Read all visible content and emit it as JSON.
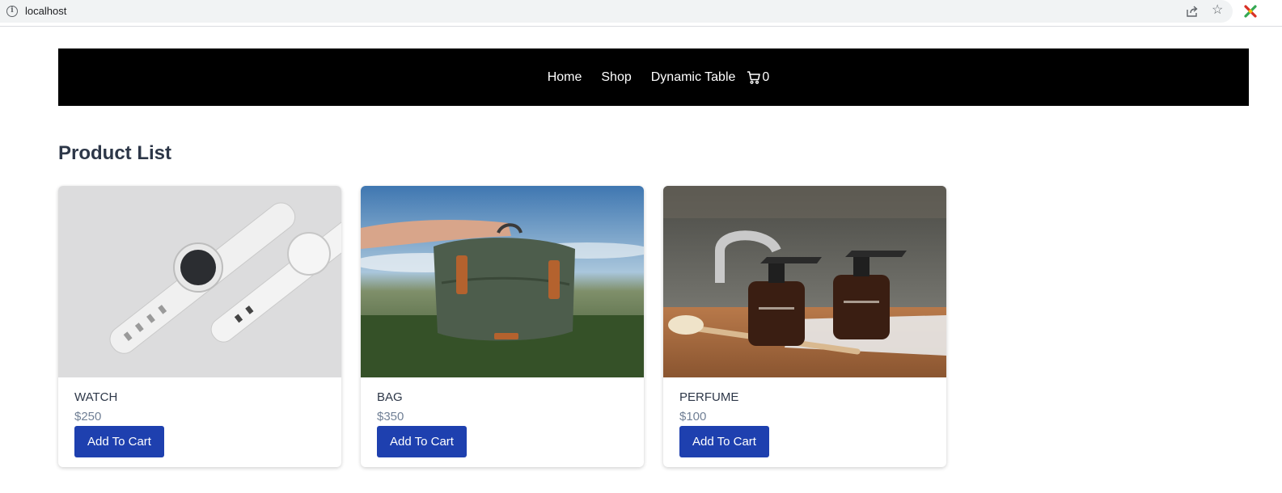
{
  "browser": {
    "url": "localhost"
  },
  "nav": {
    "links": [
      "Home",
      "Shop",
      "Dynamic Table"
    ],
    "cart_count": "0"
  },
  "page": {
    "title": "Product List"
  },
  "products": [
    {
      "name": "WATCH",
      "price": "$250",
      "button_label": "Add To Cart"
    },
    {
      "name": "BAG",
      "price": "$350",
      "button_label": "Add To Cart"
    },
    {
      "name": "PERFUME",
      "price": "$100",
      "button_label": "Add To Cart"
    }
  ],
  "colors": {
    "navbar_bg": "#000000",
    "button_bg": "#1e40af",
    "title_text": "#2d3748",
    "price_text": "#718096"
  },
  "icons": [
    "info-icon",
    "share-icon",
    "star-icon",
    "extension-icon",
    "cart-icon"
  ]
}
